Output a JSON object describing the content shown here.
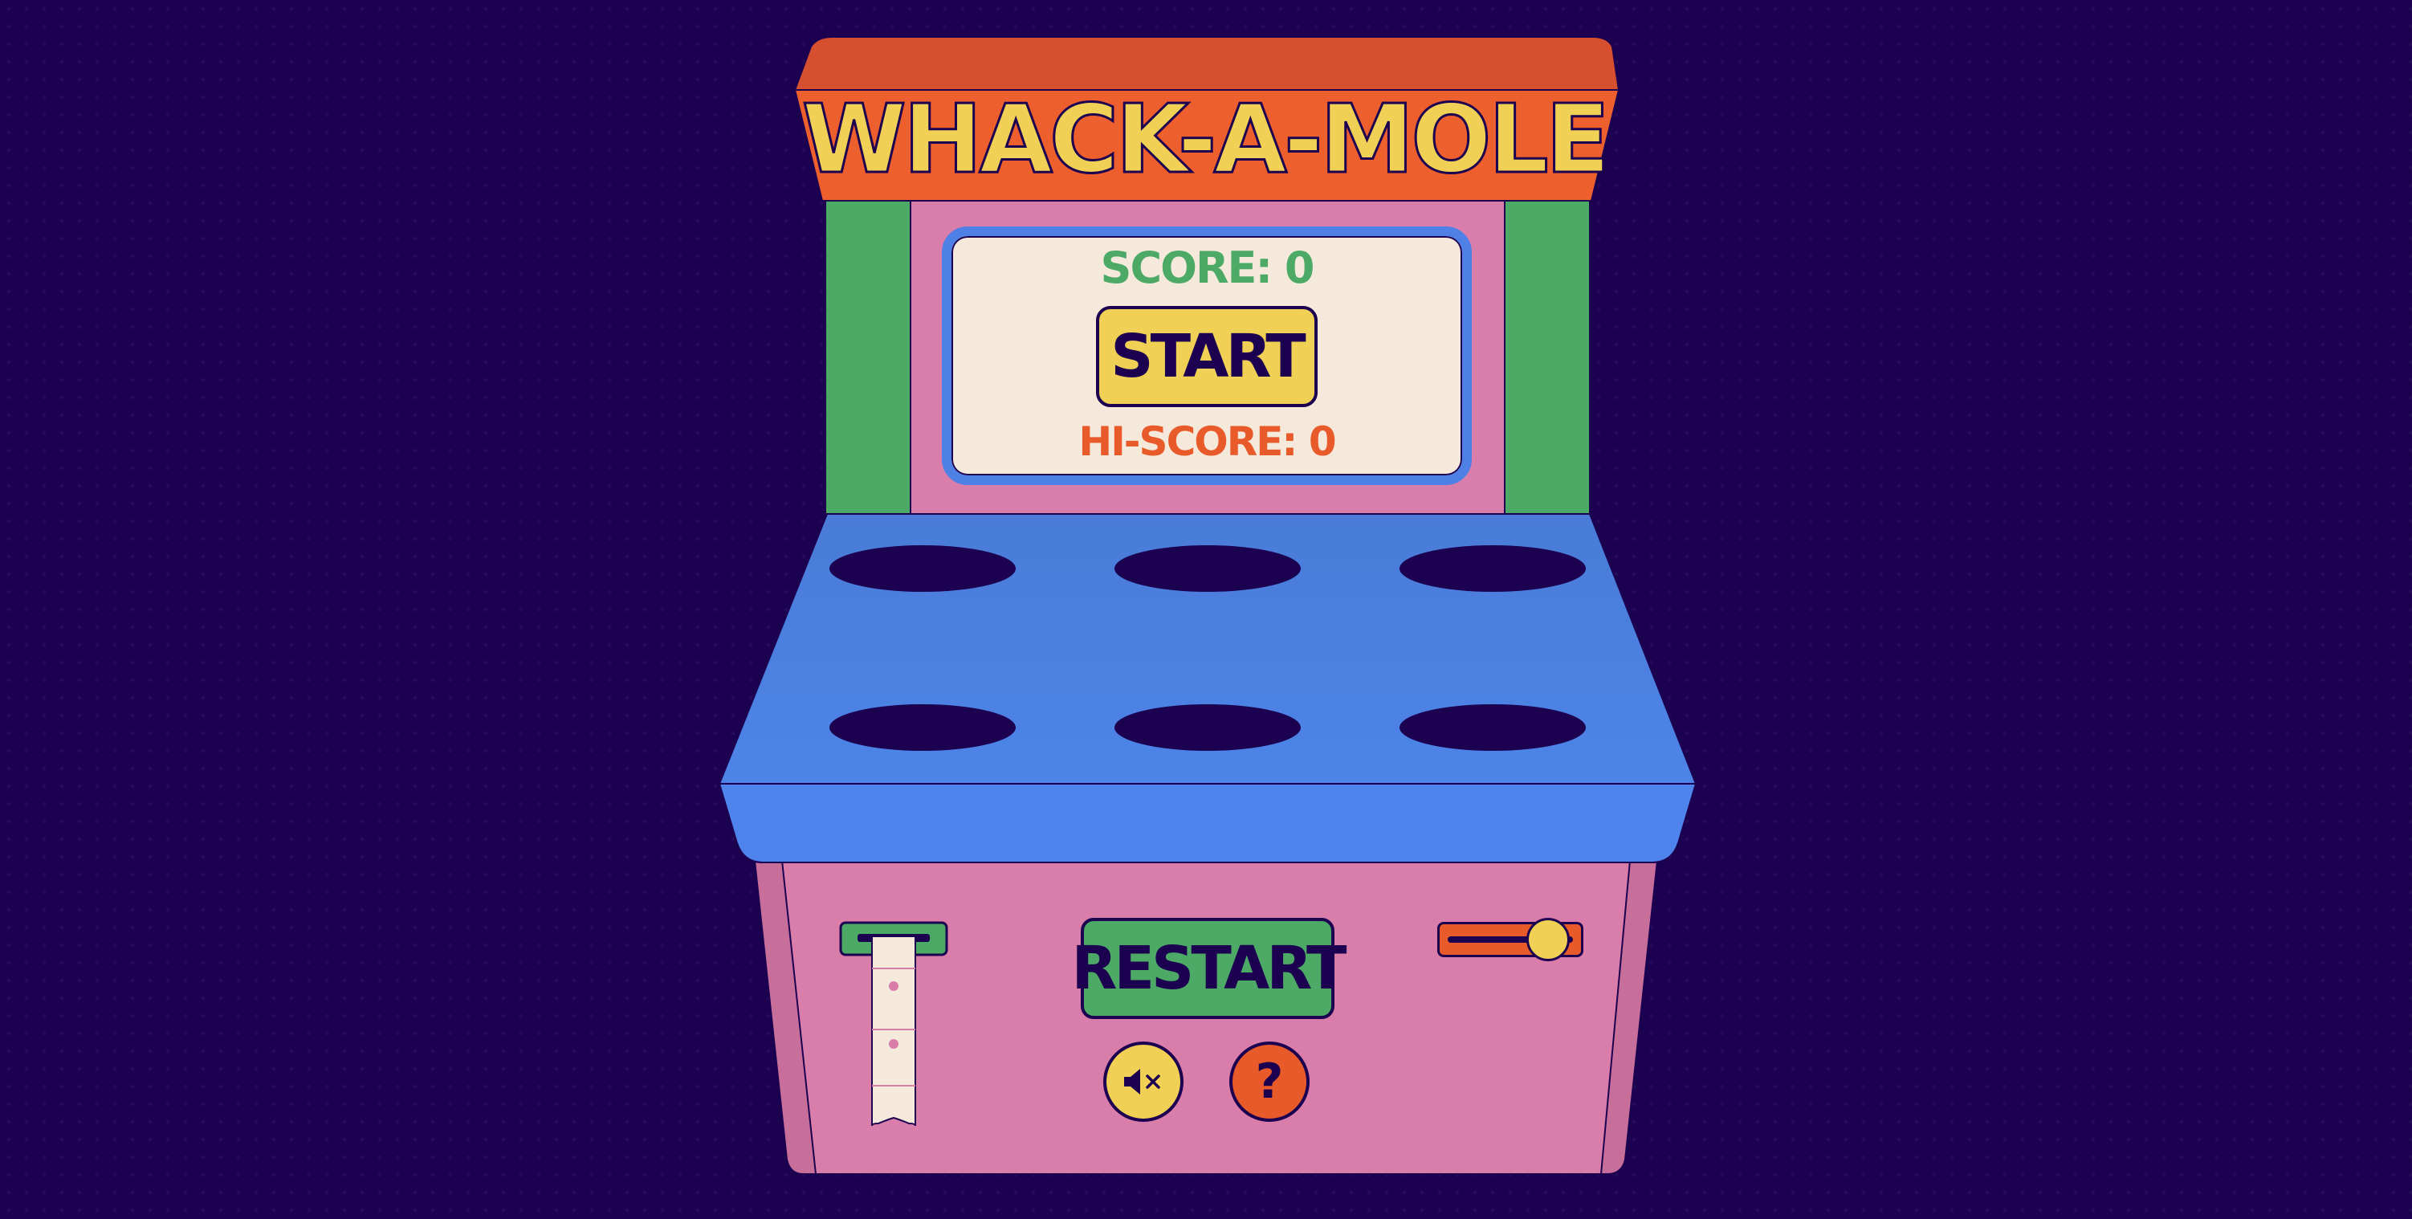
{
  "game": {
    "title": "WHACK-A-MOLE"
  },
  "screen": {
    "score_label": "SCORE:",
    "score": "0",
    "start_label": "START",
    "hiscore_label": "HI-SCORE:",
    "hiscore": "0"
  },
  "board": {
    "holes": 6
  },
  "controls": {
    "restart_label": "RESTART",
    "help_label": "?",
    "mute_icon": "speaker-muted-icon",
    "volume_level": 0.8
  },
  "colors": {
    "background": "#1b0150",
    "marquee_top": "#d64f2e",
    "marquee_front": "#ee5f2e",
    "title_text": "#f0d055",
    "side_panels": "#4caa66",
    "screen_frame": "#4f80e6",
    "screen_bg": "#f4e9da",
    "score_text": "#4caa66",
    "hiscore_text": "#e85a2a",
    "board": "#4f80e6",
    "cabinet": "#d97eab"
  }
}
